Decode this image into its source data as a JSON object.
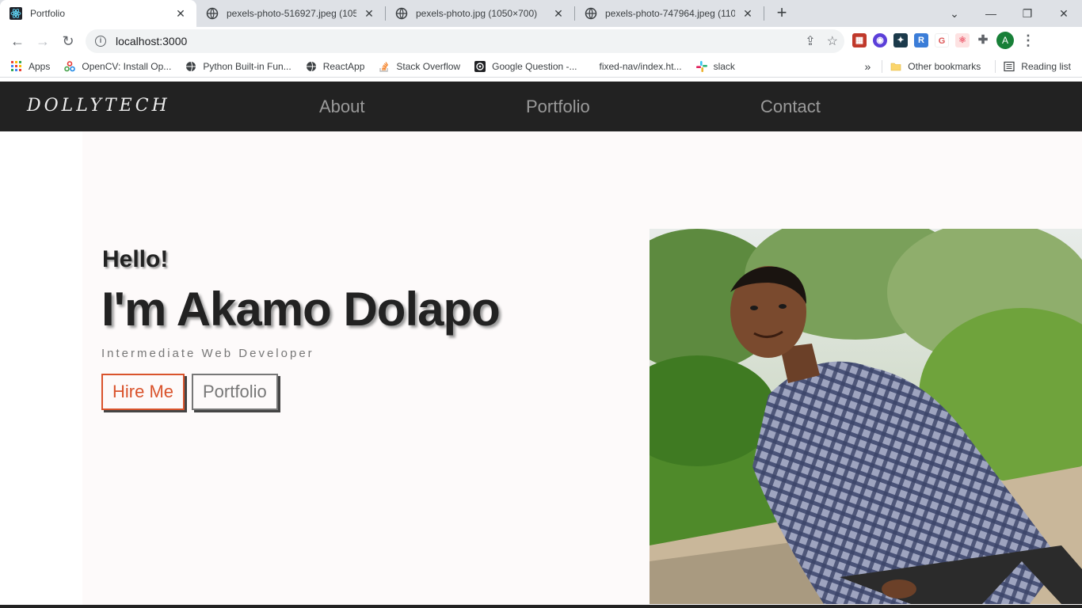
{
  "browser": {
    "tabs": [
      {
        "title": "Portfolio",
        "active": true
      },
      {
        "title": "pexels-photo-516927.jpeg (1050",
        "active": false
      },
      {
        "title": "pexels-photo.jpg (1050×700)",
        "active": false
      },
      {
        "title": "pexels-photo-747964.jpeg (1109",
        "active": false
      }
    ],
    "address": "localhost:3000",
    "profile_initial": "A",
    "bookmarks": [
      "Apps",
      "OpenCV: Install Op...",
      "Python Built-in Fun...",
      "ReactApp",
      "Stack Overflow",
      "Google Question -...",
      "fixed-nav/index.ht...",
      "slack"
    ],
    "other_bookmarks": "Other bookmarks",
    "reading_list": "Reading list"
  },
  "site": {
    "logo": "DOLLYTECH",
    "nav": [
      "About",
      "Portfolio",
      "Contact"
    ],
    "hero": {
      "greeting": "Hello!",
      "name": "I'm Akamo Dolapo",
      "role": "Intermediate Web Developer",
      "hire_button": "Hire Me",
      "portfolio_button": "Portfolio"
    }
  },
  "colors": {
    "accent": "#d9532c",
    "nav_bg": "#222222"
  }
}
